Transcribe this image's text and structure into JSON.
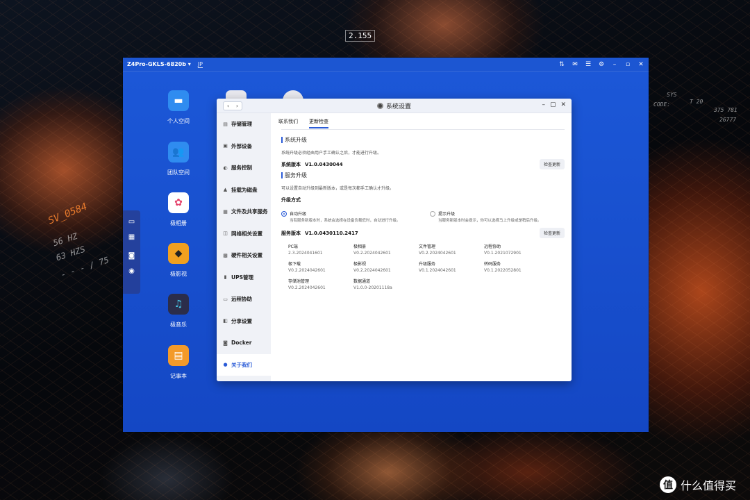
{
  "background": {
    "code_label": "2.155",
    "left_texts": [
      "SV_0584",
      "56 HZ",
      "63 HZS",
      "- - - / 75"
    ],
    "right_texts": [
      "SYS",
      "T 20",
      "CODE:",
      "375 781",
      "26777"
    ]
  },
  "nas": {
    "device": "Z4Pro-GKLS-6820b",
    "lang": "JP",
    "toolbar_icons": [
      "transfer-icon",
      "message-icon",
      "user-icon",
      "settings-icon",
      "minimize-icon",
      "maximize-icon",
      "close-icon"
    ]
  },
  "desktop_apps": [
    {
      "label": "个人空间",
      "icon": "folder-icon",
      "color": "#2f8cf0"
    },
    {
      "label": "团队空间",
      "icon": "team-folder-icon",
      "color": "#2f8cf0"
    },
    {
      "label": "极相册",
      "icon": "photos-icon",
      "color": "#ffffff"
    },
    {
      "label": "极影视",
      "icon": "video-icon",
      "color": "#f0a020"
    },
    {
      "label": "极音乐",
      "icon": "music-icon",
      "color": "#2b2d4a"
    },
    {
      "label": "记事本",
      "icon": "notepad-icon",
      "color": "#f39a2a"
    }
  ],
  "window": {
    "title": "系统设置",
    "sidebar": [
      {
        "label": "存储管理",
        "icon": "storage-icon"
      },
      {
        "label": "外部设备",
        "icon": "device-icon"
      },
      {
        "label": "服务控制",
        "icon": "service-icon"
      },
      {
        "label": "挂载为磁盘",
        "icon": "mount-icon"
      },
      {
        "label": "文件及共享服务",
        "icon": "share-icon"
      },
      {
        "label": "网络相关设置",
        "icon": "network-icon"
      },
      {
        "label": "硬件相关设置",
        "icon": "hardware-icon"
      },
      {
        "label": "UPS管理",
        "icon": "ups-icon"
      },
      {
        "label": "远程协助",
        "icon": "remote-icon"
      },
      {
        "label": "分享设置",
        "icon": "share-settings-icon"
      },
      {
        "label": "Docker",
        "icon": "docker-icon"
      },
      {
        "label": "关于我们",
        "icon": "about-icon"
      }
    ],
    "tabs": [
      {
        "label": "联系我们"
      },
      {
        "label": "更新检查"
      }
    ],
    "system_upgrade": {
      "title": "系统升级",
      "desc": "系统升级必须经由用户手工确认之后，才能进行升级。",
      "version_label": "系统版本",
      "version": "V1.0.0430044",
      "check_button": "检查更新"
    },
    "service_upgrade": {
      "title": "服务升级",
      "desc": "可以设置自动升级到最新版本，或是每次都手工确认才升级。",
      "mode_label": "升级方式",
      "modes": [
        {
          "title": "自动升级",
          "desc": "当有服务新版本时，系统会选择在设备负载低时，自动进行升级。",
          "selected": true
        },
        {
          "title": "提示升级",
          "desc": "当服务新版本时会提示，你可以选择马上升级或是稍后升级。",
          "selected": false
        }
      ],
      "version_label": "服务版本",
      "version": "V1.0.0430110.2417",
      "check_button": "检查更新",
      "services": [
        {
          "name": "PC端",
          "version": "2.3.2024041601"
        },
        {
          "name": "极相册",
          "version": "V0.2.2024042601"
        },
        {
          "name": "文件管理",
          "version": "V0.2.2024042601"
        },
        {
          "name": "远程协助",
          "version": "V0.1.2021072901"
        },
        {
          "name": "极下载",
          "version": "V0.2.2024042601"
        },
        {
          "name": "极影视",
          "version": "V0.2.2024042601"
        },
        {
          "name": "升级服务",
          "version": "V0.1.2024042601"
        },
        {
          "name": "转码服务",
          "version": "V0.1.2022052801"
        },
        {
          "name": "存储池管理",
          "version": "V0.2.2024042601"
        },
        {
          "name": "数据通道",
          "version": "V1.0.0-20201118a"
        }
      ]
    }
  },
  "watermark": {
    "logo": "值",
    "text": "什么值得买"
  }
}
